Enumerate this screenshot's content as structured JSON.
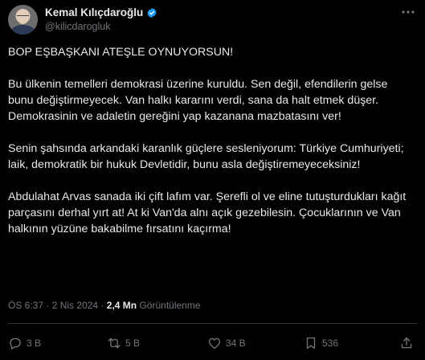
{
  "author": {
    "name": "Kemal Kılıçdaroğlu",
    "handle": "@kilicdarogluk",
    "avatar_icon": "profile-photo",
    "verified_icon": "verified-badge-icon"
  },
  "tweet": {
    "paragraphs": [
      "BOP EŞBAŞKANI ATEŞLE OYNUYORSUN!",
      "Bu ülkenin temelleri demokrasi üzerine kuruldu. Sen değil, efendilerin gelse bunu değiştirmeyecek. Van halkı kararını verdi, sana da halt etmek düşer. Demokrasinin ve adaletin gereğini yap kazanana mazbatasını ver!",
      "Senin şahsında arkandaki karanlık güçlere sesleniyorum: Türkiye Cumhuriyeti; laik, demokratik bir hukuk Devletidir, bunu asla değiştiremeyeceksiniz!",
      "Abdulahat Arvas sanada iki çift lafım var. Şerefli ol ve eline tutuşturdukları kağıt parçasını derhal yırt at! At ki Van'da alnı açık gezebilesin. Çocuklarının ve Van halkının yüzüne bakabilme fırsatını kaçırma!"
    ],
    "time": "ÖS 6:37",
    "separator": "·",
    "date": "2 Nis 2024",
    "views_count": "2,4 Mn",
    "views_label": "Görüntülenme"
  },
  "actions": {
    "replies": "3 B",
    "retweets": "5 B",
    "likes": "34 B",
    "bookmarks": "536"
  },
  "colors": {
    "background": "#000000",
    "text": "#e7e9ea",
    "muted": "#71767b",
    "verified": "#1d9bf0",
    "divider": "#2f3336"
  }
}
